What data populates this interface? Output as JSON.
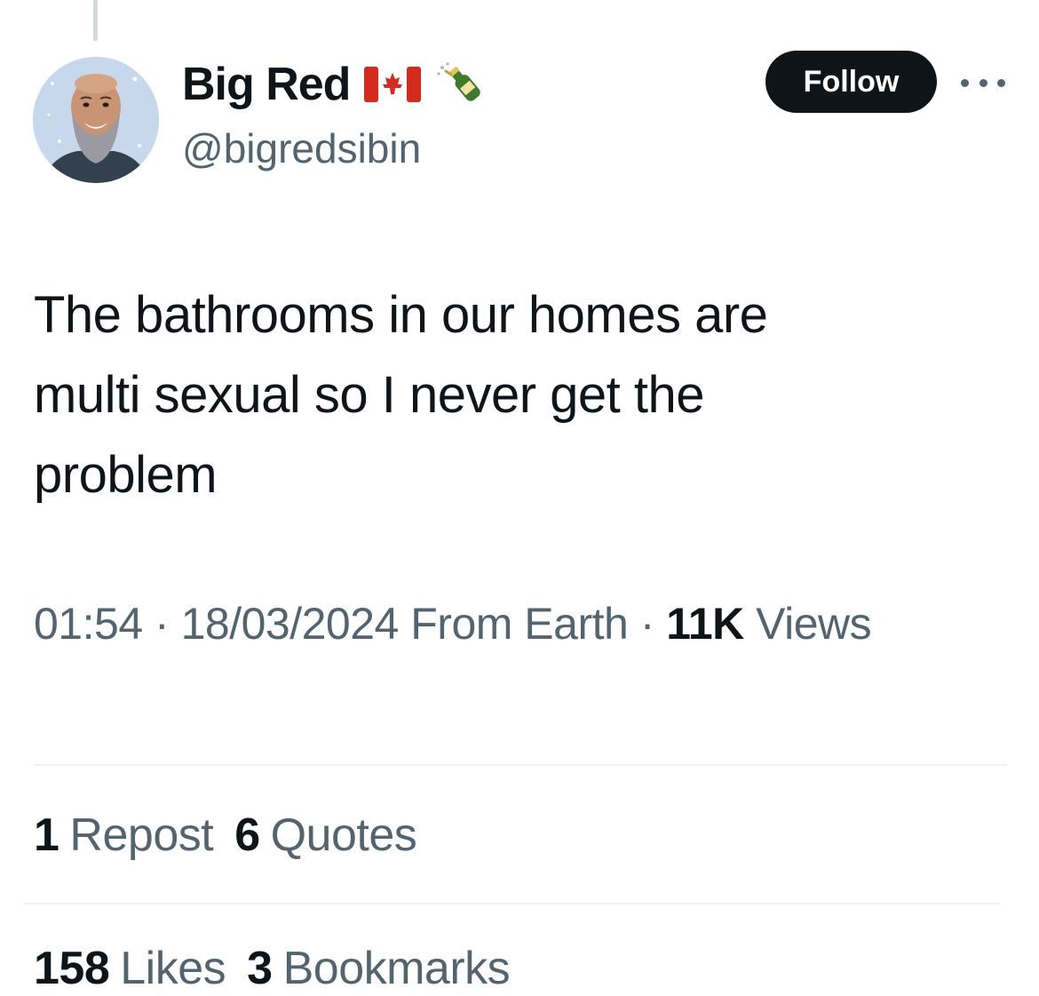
{
  "author": {
    "display_name": "Big Red",
    "name_emojis": [
      "canada-flag-icon",
      "champagne-bottle-icon"
    ],
    "handle": "@bigredsibin"
  },
  "actions": {
    "follow_label": "Follow",
    "more_icon": "more-options-icon"
  },
  "tweet": {
    "lines": [
      "The bathrooms in our homes are",
      "multi sexual so I never get the",
      "problem"
    ]
  },
  "meta": {
    "time": "01:54",
    "separator": "·",
    "date": "18/03/2024",
    "source": "From Earth",
    "views_count": "11K",
    "views_label": "Views"
  },
  "stats": {
    "reposts_count": "1",
    "reposts_label": "Repost",
    "quotes_count": "6",
    "quotes_label": "Quotes",
    "likes_count": "158",
    "likes_label": "Likes",
    "bookmarks_count": "3",
    "bookmarks_label": "Bookmarks"
  },
  "colors": {
    "text_primary": "#0f1419",
    "text_secondary": "#536471",
    "divider": "#eff3f4",
    "follow_bg": "#0f1419"
  }
}
